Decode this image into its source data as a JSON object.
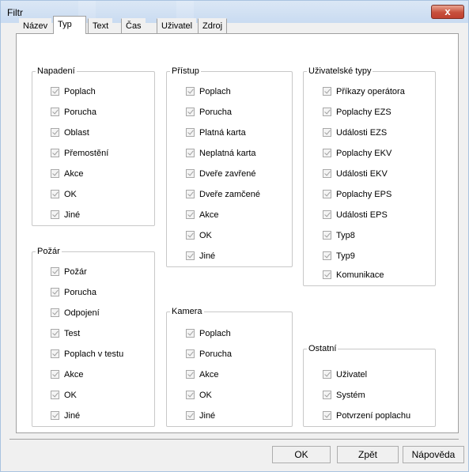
{
  "window": {
    "title": "Filtr",
    "close_glyph": "x"
  },
  "tabs": [
    {
      "label": "Název"
    },
    {
      "label": "Typ"
    },
    {
      "label": "Text"
    },
    {
      "label": "Čas"
    },
    {
      "label": "Uživatel"
    },
    {
      "label": "Zdroj"
    }
  ],
  "active_tab": "Typ",
  "groups": {
    "napadeni": {
      "title": "Napadení",
      "items": [
        "Poplach",
        "Porucha",
        "Oblast",
        "Přemostění",
        "Akce",
        "OK",
        "Jiné"
      ]
    },
    "pozar": {
      "title": "Požár",
      "items": [
        "Požár",
        "Porucha",
        "Odpojení",
        "Test",
        "Poplach v testu",
        "Akce",
        "OK",
        "Jiné"
      ]
    },
    "pristup": {
      "title": "Přístup",
      "items": [
        "Poplach",
        "Porucha",
        "Platná karta",
        "Neplatná karta",
        "Dveře zavřené",
        "Dveře zamčené",
        "Akce",
        "OK",
        "Jiné"
      ]
    },
    "kamera": {
      "title": "Kamera",
      "items": [
        "Poplach",
        "Porucha",
        "Akce",
        "OK",
        "Jiné"
      ]
    },
    "uzivatelske": {
      "title": "Uživatelské typy",
      "items": [
        "Příkazy operátora",
        "Poplachy EZS",
        "Události EZS",
        "Poplachy EKV",
        "Události EKV",
        "Poplachy EPS",
        "Události EPS",
        "Typ8",
        "Typ9",
        "Komunikace"
      ]
    },
    "ostatni": {
      "title": "Ostatní",
      "items": [
        "Uživatel",
        "Systém",
        "Potvrzení poplachu"
      ]
    }
  },
  "buttons": {
    "ok": "OK",
    "back": "Zpět",
    "help": "Nápověda"
  }
}
